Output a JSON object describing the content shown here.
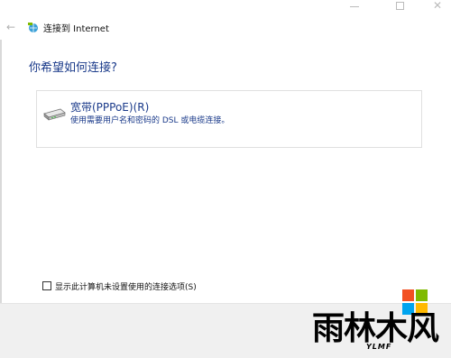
{
  "window": {
    "title": "连接到 Internet",
    "back_glyph": "←",
    "close_glyph": "✕"
  },
  "main": {
    "heading": "你希望如何连接?"
  },
  "option": {
    "title": "宽带(PPPoE)(R)",
    "description": "使用需要用户名和密码的 DSL 或电缆连接。",
    "icon": "modem-icon"
  },
  "checkbox": {
    "label": "显示此计算机未设置使用的连接选项(S)",
    "checked": false
  },
  "watermark": {
    "main_text": "雨林木风",
    "sub_text": "YLMF",
    "colors": [
      "#f25022",
      "#7fba00",
      "#00a4ef",
      "#ffb900"
    ]
  }
}
